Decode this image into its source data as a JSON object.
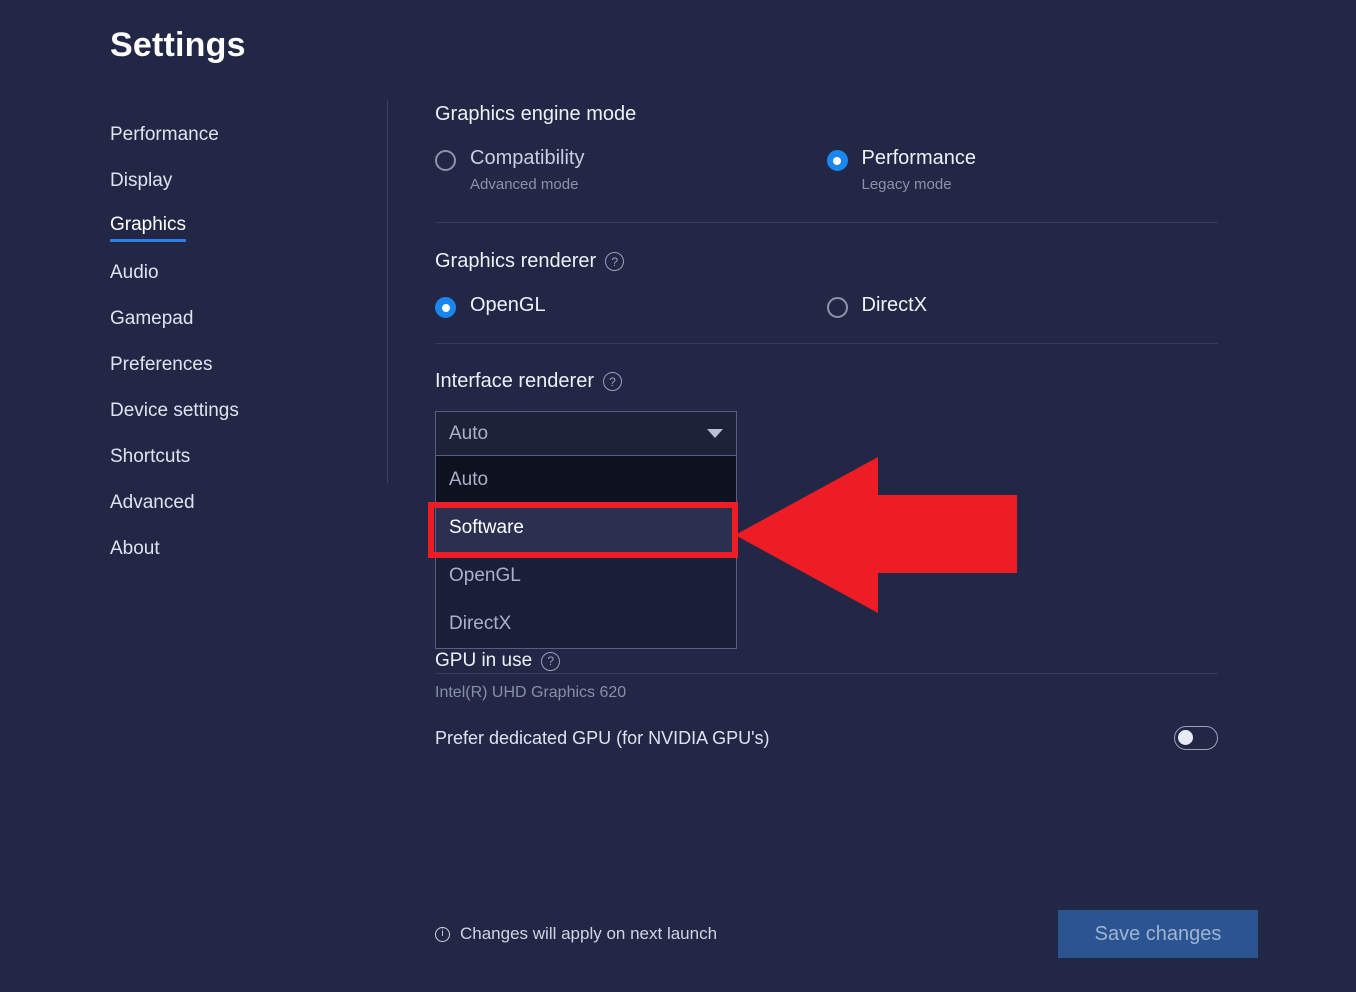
{
  "header": {
    "title": "Settings"
  },
  "sidebar": {
    "items": [
      {
        "label": "Performance",
        "active": false
      },
      {
        "label": "Display",
        "active": false
      },
      {
        "label": "Graphics",
        "active": true
      },
      {
        "label": "Audio",
        "active": false
      },
      {
        "label": "Gamepad",
        "active": false
      },
      {
        "label": "Preferences",
        "active": false
      },
      {
        "label": "Device settings",
        "active": false
      },
      {
        "label": "Shortcuts",
        "active": false
      },
      {
        "label": "Advanced",
        "active": false
      },
      {
        "label": "About",
        "active": false
      }
    ]
  },
  "engine_mode": {
    "heading": "Graphics engine mode",
    "options": [
      {
        "label": "Compatibility",
        "sub": "Advanced mode",
        "selected": false
      },
      {
        "label": "Performance",
        "sub": "Legacy mode",
        "selected": true
      }
    ]
  },
  "graphics_renderer": {
    "heading": "Graphics renderer",
    "help_icon": "help-circle-icon",
    "options": [
      {
        "label": "OpenGL",
        "selected": true
      },
      {
        "label": "DirectX",
        "selected": false
      }
    ]
  },
  "interface_renderer": {
    "heading": "Interface renderer",
    "help_icon": "help-circle-icon",
    "selected_value": "Auto",
    "caret_icon": "chevron-down-icon",
    "open": true,
    "options": [
      {
        "label": "Auto",
        "state": "first"
      },
      {
        "label": "Software",
        "state": "hovered"
      },
      {
        "label": "OpenGL",
        "state": "normal"
      },
      {
        "label": "DirectX",
        "state": "normal"
      }
    ]
  },
  "gpu": {
    "title": "GPU in use",
    "help_icon": "help-circle-icon",
    "value": "Intel(R) UHD Graphics 620",
    "prefer_label": "Prefer dedicated GPU (for NVIDIA GPU's)",
    "prefer_enabled": false
  },
  "footer": {
    "info_icon": "info-circle-icon",
    "note": "Changes will apply on next launch",
    "save_label": "Save changes"
  },
  "annotations": {
    "highlight_target": "Software",
    "arrow_color": "#ee1c25",
    "box_color": "#ee1c25",
    "arrow_direction": "left"
  },
  "colors": {
    "background": "#222745",
    "accent_blue": "#1a86f0",
    "save_button": "#2a5590",
    "annotation_red": "#ee1c25"
  }
}
